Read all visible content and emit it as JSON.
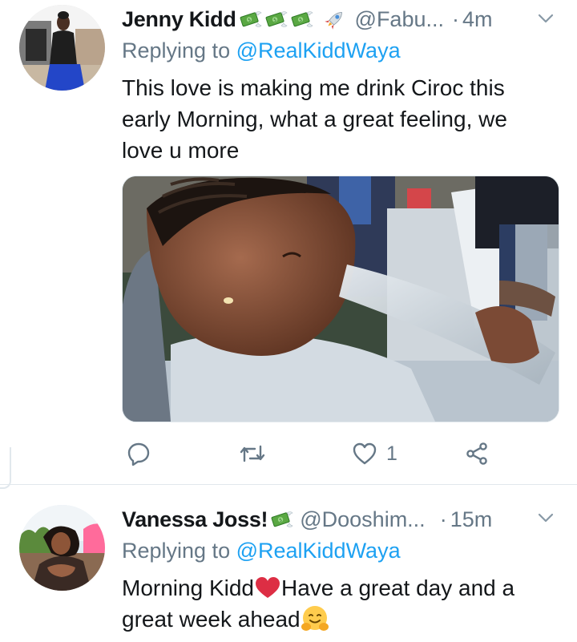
{
  "tweets": [
    {
      "author_name": "Jenny Kidd",
      "name_emojis": [
        "money-with-wings-emoji",
        "money-with-wings-emoji",
        "money-with-wings-emoji",
        "rocket-emoji"
      ],
      "handle": "@Fabu...",
      "separator": "·",
      "time": "4m",
      "reply_prefix": "Replying to ",
      "reply_to": "@RealKiddWaya",
      "text": "This love is making me drink Ciroc this early Morning, what a great feeling, we love u more",
      "media": "child drinking from wine glass photo",
      "actions": {
        "reply_count": "",
        "retweet_count": "",
        "like_count": "1"
      }
    },
    {
      "author_name": "Vanessa Joss!",
      "name_emojis": [
        "money-with-wings-emoji"
      ],
      "handle": "@Dooshim...",
      "separator": "·",
      "time": "15m",
      "reply_prefix": "Replying to ",
      "reply_to": "@RealKiddWaya",
      "text_part1": "Morning Kidd",
      "text_part2": "Have a great day and a great week ahead",
      "text_emojis": [
        "red-heart-emoji",
        "hugging-face-emoji"
      ]
    }
  ],
  "colors": {
    "text": "#14171a",
    "secondary": "#657786",
    "link": "#1da1f2",
    "divider": "#e1e8ed"
  }
}
